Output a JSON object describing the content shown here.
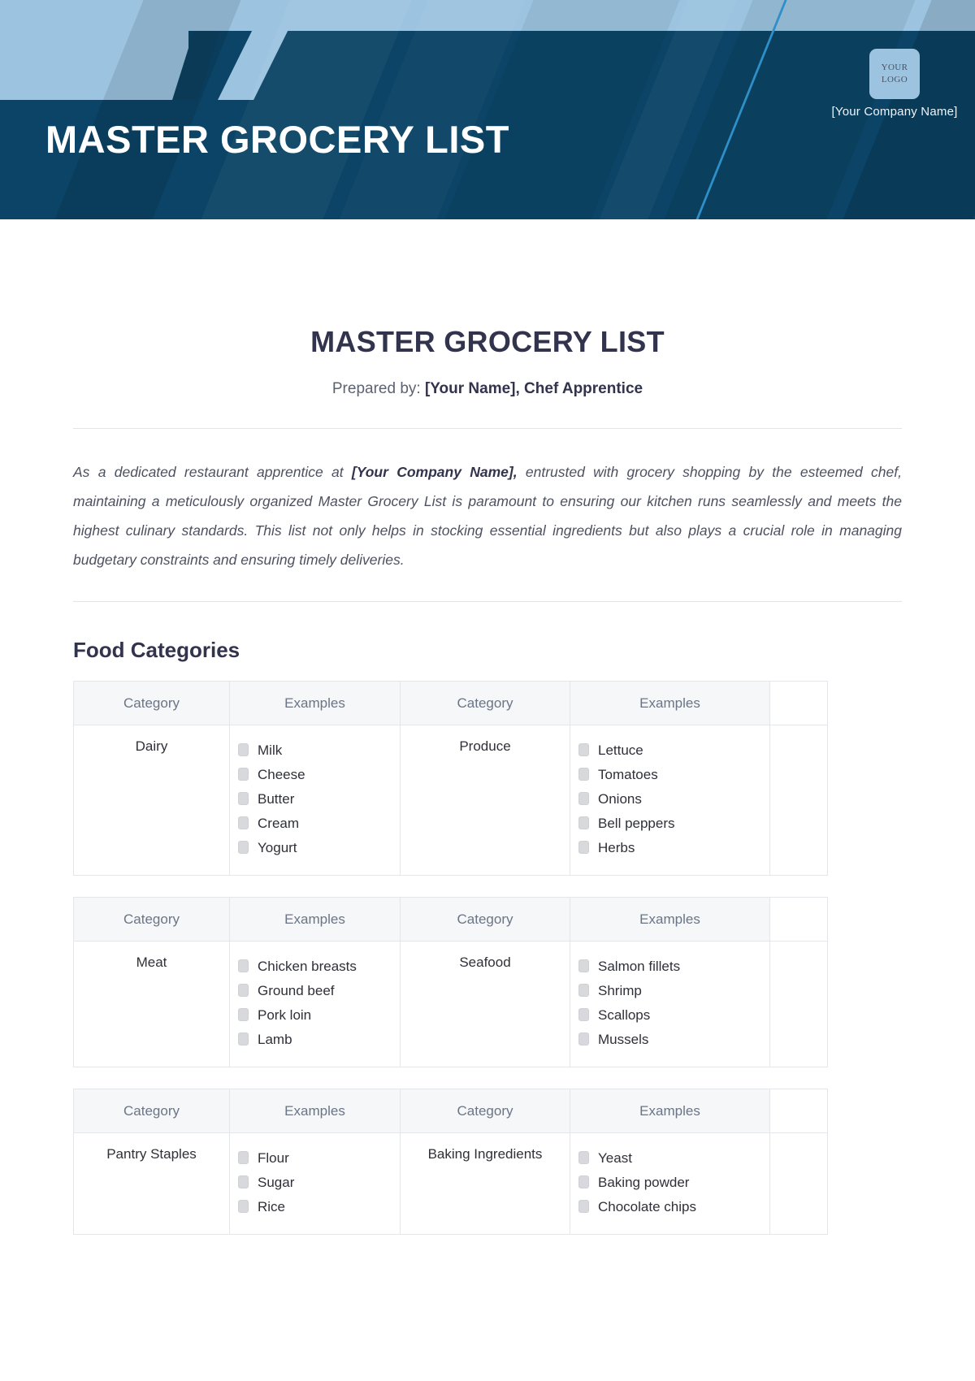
{
  "banner": {
    "title": "MASTER GROCERY LIST",
    "logo_line1": "YOUR",
    "logo_line2": "LOGO",
    "company_name": "[Your Company Name]",
    "colors": {
      "navy": "#0b4466",
      "light_blue": "#9cc4e0",
      "accent_line": "#2e8fc9"
    }
  },
  "document": {
    "title": "MASTER GROCERY LIST",
    "prepared_label": "Prepared by:",
    "prepared_value": "[Your Name], Chef Apprentice",
    "intro_part1": "As a dedicated restaurant apprentice at ",
    "intro_company": "[Your Company Name],",
    "intro_part2": " entrusted with grocery shopping by the esteemed chef, maintaining a meticulously organized Master Grocery List is paramount to ensuring our kitchen runs seamlessly and meets the highest culinary standards. This list not only helps in stocking essential ingredients but also plays a crucial role in managing budgetary constraints and ensuring timely deliveries.",
    "section_title": "Food Categories"
  },
  "table_headers": {
    "category": "Category",
    "examples": "Examples",
    "blank": ""
  },
  "tables": [
    {
      "left_category": "Dairy",
      "left_items": [
        "Milk",
        "Cheese",
        "Butter",
        "Cream",
        "Yogurt"
      ],
      "right_category": "Produce",
      "right_items": [
        "Lettuce",
        "Tomatoes",
        "Onions",
        "Bell peppers",
        "Herbs"
      ]
    },
    {
      "left_category": "Meat",
      "left_items": [
        "Chicken breasts",
        "Ground beef",
        "Pork loin",
        "Lamb"
      ],
      "right_category": "Seafood",
      "right_items": [
        "Salmon fillets",
        "Shrimp",
        "Scallops",
        "Mussels"
      ]
    },
    {
      "left_category": "Pantry Staples",
      "left_items": [
        "Flour",
        "Sugar",
        "Rice"
      ],
      "right_category": "Baking Ingredients",
      "right_items": [
        "Yeast",
        "Baking powder",
        "Chocolate chips"
      ]
    }
  ]
}
